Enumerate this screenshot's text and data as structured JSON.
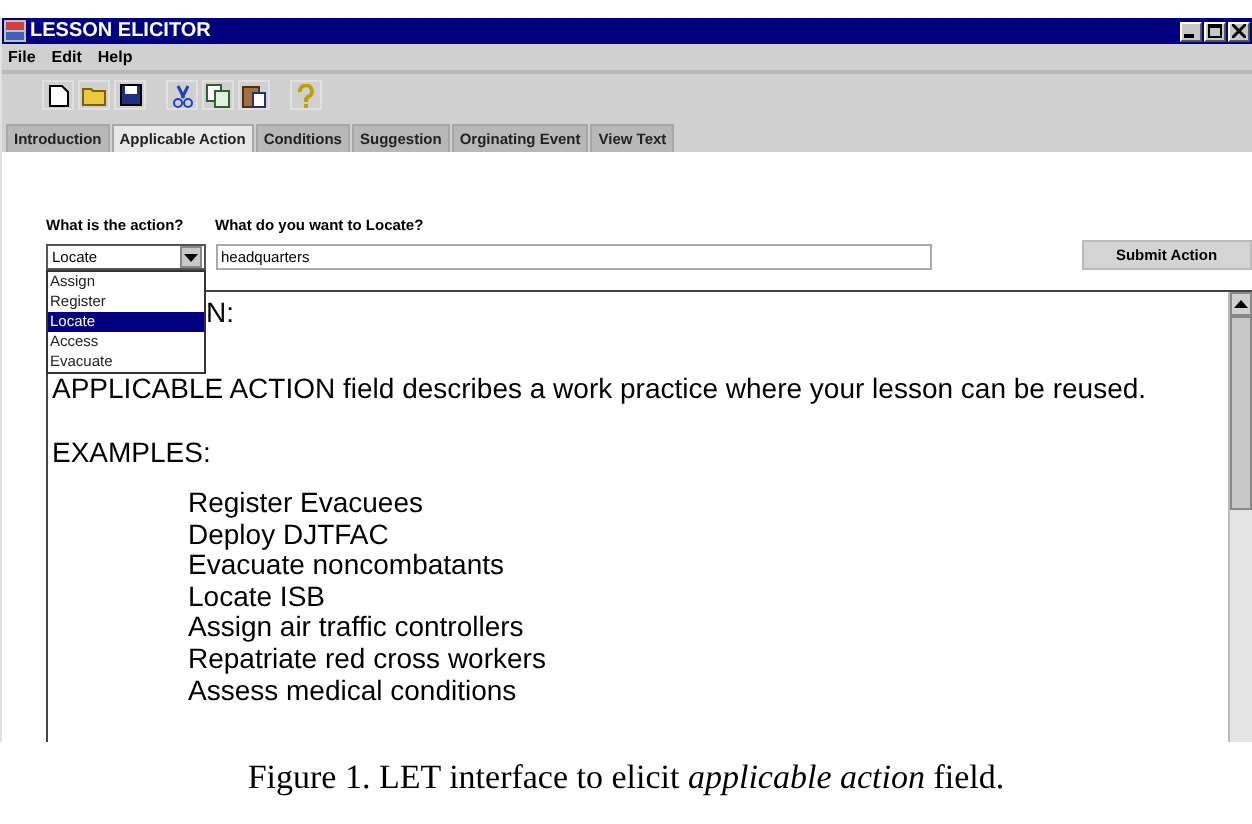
{
  "window": {
    "title": "LESSON ELICITOR"
  },
  "menu": [
    "File",
    "Edit",
    "Help"
  ],
  "toolbar": [
    {
      "kind": "new"
    },
    {
      "kind": "open"
    },
    {
      "kind": "save"
    },
    {
      "kind": "cut"
    },
    {
      "kind": "copy"
    },
    {
      "kind": "paste"
    },
    {
      "kind": "help"
    }
  ],
  "tabs": [
    {
      "label": "Introduction",
      "selected": false
    },
    {
      "label": "Applicable Action",
      "selected": true
    },
    {
      "label": "Conditions",
      "selected": false
    },
    {
      "label": "Suggestion",
      "selected": false
    },
    {
      "label": "Orginating Event",
      "selected": false
    },
    {
      "label": "View Text",
      "selected": false
    }
  ],
  "action_label": "What is the action?",
  "action_select": {
    "value": "Locate",
    "expanded": true,
    "options": [
      {
        "label": "Assign",
        "selected": false
      },
      {
        "label": "Register",
        "selected": false
      },
      {
        "label": "Locate",
        "selected": true
      },
      {
        "label": "Access",
        "selected": false
      },
      {
        "label": "Evacuate",
        "selected": false
      }
    ]
  },
  "locate_label": "What do you want to Locate?",
  "locate_field": {
    "value": "headquarters"
  },
  "submit_button": "Submit Action",
  "text_area": {
    "heading": "N:",
    "description": "APPLICABLE ACTION field describes a work practice where your lesson can be reused.",
    "examples_heading": "EXAMPLES:",
    "examples": [
      "Register Evacuees",
      "Deploy DJTFAC",
      "Evacuate noncombatants",
      "Locate ISB",
      "Assign air traffic controllers",
      "Repatriate red cross workers",
      "Assess medical conditions"
    ]
  },
  "caption": "Figure 1. LET interface to elicit *applicable action* field."
}
